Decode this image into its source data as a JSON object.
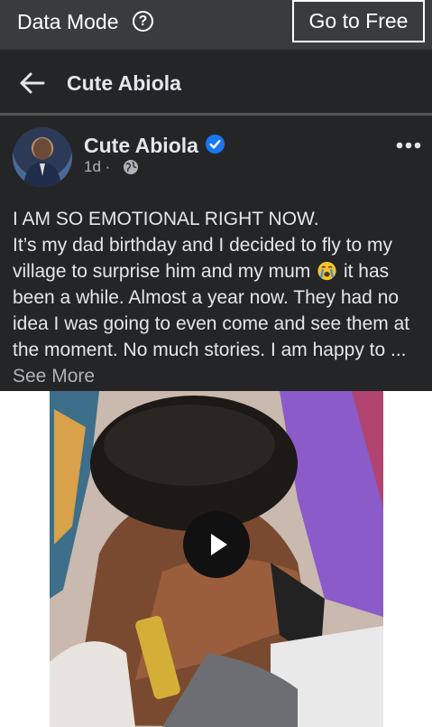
{
  "topbar": {
    "data_mode_label": "Data Mode",
    "help_icon": "?",
    "go_free_label": "Go to Free"
  },
  "header": {
    "back_icon": "arrow-left-icon",
    "title": "Cute Abiola"
  },
  "post": {
    "author": "Cute Abiola",
    "timestamp": "1d",
    "dot": "·",
    "privacy_icon": "globe-icon",
    "more_icon": "more-icon",
    "text_line1": "I AM SO EMOTIONAL RIGHT NOW.",
    "text_part1": "It’s my dad birthday and I decided to fly to my village to surprise him and my mum ",
    "text_part2": " it has been a while. Almost a year now. They had no idea I was going to even come and see them at the moment. No much stories. I am happy to ... ",
    "see_more": "See More",
    "emoji_icon": "crying-face-emoji",
    "media": {
      "type": "video",
      "play_icon": "play-icon"
    }
  },
  "colors": {
    "bg": "#242526",
    "topbar": "#3a3b3c",
    "verified": "#1877f2",
    "text": "#e4e6eb",
    "muted": "#b0b3b8"
  }
}
